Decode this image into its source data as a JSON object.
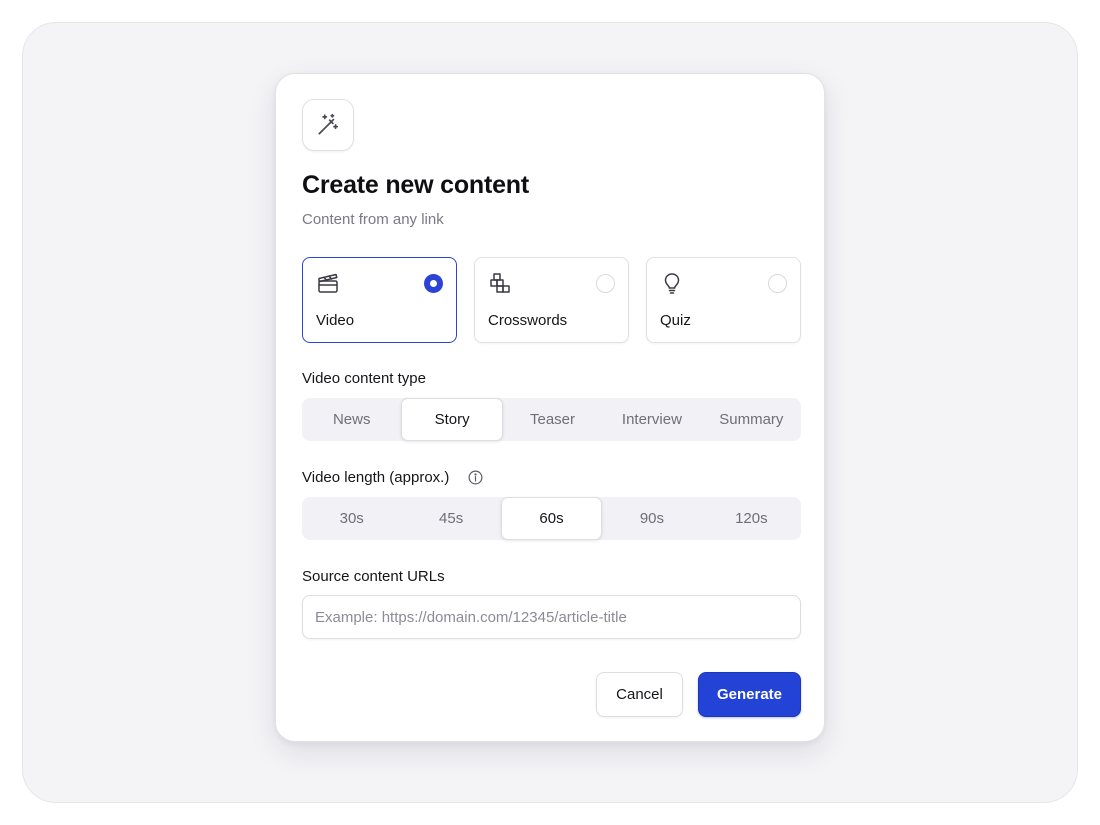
{
  "colors": {
    "accent": "#2343d6",
    "backdrop": "#f4f3f6",
    "muted_text": "#7a7986"
  },
  "dialog": {
    "icon": "magic-wand-icon",
    "title": "Create new content",
    "subtitle": "Content from any link"
  },
  "content_types": {
    "selected": "Video",
    "items": [
      {
        "label": "Video",
        "icon": "clapperboard-icon",
        "selected": true
      },
      {
        "label": "Crosswords",
        "icon": "crossword-grid-icon",
        "selected": false
      },
      {
        "label": "Quiz",
        "icon": "lightbulb-icon",
        "selected": false
      }
    ]
  },
  "video_content_type": {
    "label": "Video content type",
    "selected": "Story",
    "options": [
      "News",
      "Story",
      "Teaser",
      "Interview",
      "Summary"
    ]
  },
  "video_length": {
    "label": "Video length (approx.)",
    "info_icon": "info-icon",
    "selected": "60s",
    "options": [
      "30s",
      "45s",
      "60s",
      "90s",
      "120s"
    ]
  },
  "source_urls": {
    "label": "Source content URLs",
    "value": "",
    "placeholder": "Example: https://domain.com/12345/article-title"
  },
  "actions": {
    "cancel_label": "Cancel",
    "generate_label": "Generate"
  }
}
